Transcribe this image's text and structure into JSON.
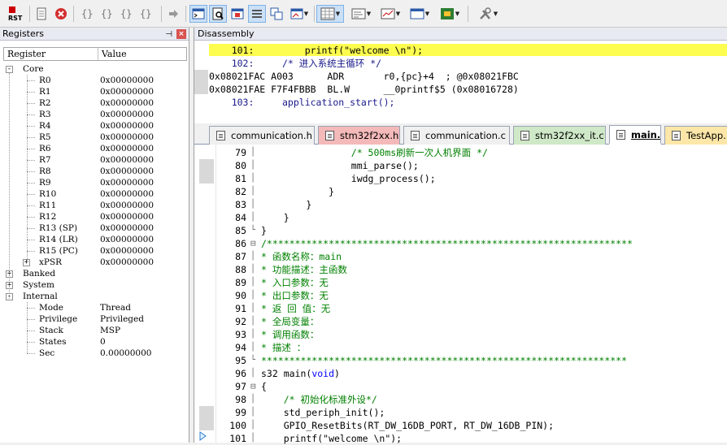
{
  "toolbar": {
    "reset_label": "RST",
    "buttons": [
      "reset-icon",
      "step-into-icon",
      "stop-icon",
      "braces-step-icon",
      "braces-over-icon",
      "braces-out-icon",
      "braces-run-icon",
      "arrow-right-icon",
      "command-window-icon",
      "disassembly-window-icon",
      "symbols-window-icon",
      "registers-window-icon",
      "call-stack-icon",
      "watch-window-icon",
      "memory-window-icon",
      "serial-window-icon",
      "analysis-window-icon",
      "trace-window-icon",
      "system-viewer-icon",
      "toolbox-icon"
    ]
  },
  "registers": {
    "title": "Registers",
    "col_register": "Register",
    "col_value": "Value",
    "groups": {
      "core": "Core",
      "banked": "Banked",
      "system": "System",
      "internal": "Internal"
    },
    "core": [
      {
        "name": "R0",
        "value": "0x00000000"
      },
      {
        "name": "R1",
        "value": "0x00000000"
      },
      {
        "name": "R2",
        "value": "0x00000000"
      },
      {
        "name": "R3",
        "value": "0x00000000"
      },
      {
        "name": "R4",
        "value": "0x00000000"
      },
      {
        "name": "R5",
        "value": "0x00000000"
      },
      {
        "name": "R6",
        "value": "0x00000000"
      },
      {
        "name": "R7",
        "value": "0x00000000"
      },
      {
        "name": "R8",
        "value": "0x00000000"
      },
      {
        "name": "R9",
        "value": "0x00000000"
      },
      {
        "name": "R10",
        "value": "0x00000000"
      },
      {
        "name": "R11",
        "value": "0x00000000"
      },
      {
        "name": "R12",
        "value": "0x00000000"
      },
      {
        "name": "R13 (SP)",
        "value": "0x00000000"
      },
      {
        "name": "R14 (LR)",
        "value": "0x00000000"
      },
      {
        "name": "R15 (PC)",
        "value": "0x00000000"
      },
      {
        "name": "xPSR",
        "value": "0x00000000"
      }
    ],
    "internal": [
      {
        "name": "Mode",
        "value": "Thread"
      },
      {
        "name": "Privilege",
        "value": "Privileged"
      },
      {
        "name": "Stack",
        "value": "MSP"
      },
      {
        "name": "States",
        "value": "0"
      },
      {
        "name": "Sec",
        "value": "0.00000000"
      }
    ]
  },
  "disassembly": {
    "title": "Disassembly",
    "lines": [
      "    101:         printf(\"welcome \\n\");",
      "    102:     /* 进入系统主循环 */",
      "0x08021FAC A003      ADR       r0,{pc}+4  ; @0x08021FBC",
      "0x08021FAE F7F4FBBB  BL.W      __0printf$5 (0x08016728)",
      "    103:     application_start();"
    ]
  },
  "tabs": [
    {
      "label": "communication.h",
      "color": "#f0f0f0",
      "active": false
    },
    {
      "label": "stm32f2xx.h",
      "color": "#f4b9b9",
      "active": false
    },
    {
      "label": "communication.c",
      "color": "#f0f0f0",
      "active": false
    },
    {
      "label": "stm32f2xx_it.c",
      "color": "#cfe8c7",
      "active": false
    },
    {
      "label": "main.c",
      "color": "#ffffff",
      "active": true
    },
    {
      "label": "TestApp.",
      "color": "#fde7a8",
      "active": false
    }
  ],
  "editor": {
    "lines": [
      {
        "n": "79",
        "code": "                /* 500ms刷新一次人机界面 */",
        "cls": "cm"
      },
      {
        "n": "80",
        "code": "                mmi_parse();",
        "cls": ""
      },
      {
        "n": "81",
        "code": "                iwdg_process();",
        "cls": ""
      },
      {
        "n": "82",
        "code": "            }",
        "cls": ""
      },
      {
        "n": "83",
        "code": "        }",
        "cls": ""
      },
      {
        "n": "84",
        "code": "    }",
        "cls": ""
      },
      {
        "n": "85",
        "code": "}",
        "cls": ""
      },
      {
        "n": "86",
        "code": "/*****************************************************************",
        "cls": "cm"
      },
      {
        "n": "87",
        "code": "* 函数名称：main",
        "cls": "cm"
      },
      {
        "n": "88",
        "code": "* 功能描述：主函数",
        "cls": "cm"
      },
      {
        "n": "89",
        "code": "* 入口参数：无",
        "cls": "cm"
      },
      {
        "n": "90",
        "code": "* 出口参数：无",
        "cls": "cm"
      },
      {
        "n": "91",
        "code": "* 返 回 值：无",
        "cls": "cm"
      },
      {
        "n": "92",
        "code": "* 全局变量：",
        "cls": "cm"
      },
      {
        "n": "93",
        "code": "* 调用函数：",
        "cls": "cm"
      },
      {
        "n": "94",
        "code": "* 描述 ：",
        "cls": "cm"
      },
      {
        "n": "95",
        "code": "*****************************************************************",
        "cls": "cm"
      },
      {
        "n": "96",
        "code": "s32 main(void)",
        "cls": ""
      },
      {
        "n": "97",
        "code": "{",
        "cls": ""
      },
      {
        "n": "98",
        "code": "    /* 初始化标准外设*/",
        "cls": "cm"
      },
      {
        "n": "99",
        "code": "    std_periph_init();",
        "cls": ""
      },
      {
        "n": "100",
        "code": "    GPIO_ResetBits(RT_DW_16DB_PORT, RT_DW_16DB_PIN);",
        "cls": ""
      },
      {
        "n": "101",
        "code": "    printf(\"welcome \\n\");",
        "cls": ""
      }
    ]
  }
}
